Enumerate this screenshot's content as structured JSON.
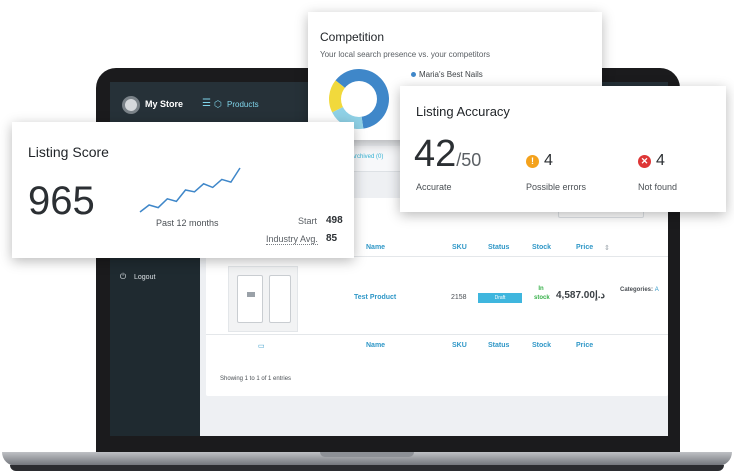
{
  "app": {
    "store_name": "My Store",
    "nav_products": "Products"
  },
  "sidebar": {
    "items": [
      {
        "label": "Logout",
        "icon": "power-icon"
      }
    ]
  },
  "tabs": {
    "archived": "Archived (0)"
  },
  "table": {
    "headers": {
      "name": "Name",
      "sku": "SKU",
      "status": "Status",
      "stock": "Stock",
      "price": "Price"
    },
    "rows": [
      {
        "name": "Test Product",
        "sku": "2158",
        "status": "Draft",
        "stock": "In stock",
        "price": "4,587.00د.إ",
        "categories_label": "Categories:",
        "categories_value": "A"
      }
    ],
    "showing": "Showing 1 to 1 of 1 entries"
  },
  "competition": {
    "title": "Competition",
    "subtitle": "Your local search presence vs. your competitors",
    "legend": [
      {
        "label": "Maria's Best Nails",
        "color": "#3f87c9"
      }
    ],
    "donut_segments": [
      {
        "value": 62,
        "color": "#3f87c9"
      },
      {
        "value": 20,
        "color": "#8fd1e6"
      },
      {
        "value": 18,
        "color": "#f1d93c"
      }
    ]
  },
  "accuracy": {
    "title": "Listing Accuracy",
    "accurate_value": "42",
    "accurate_total": "/50",
    "accurate_label": "Accurate",
    "possible_errors_value": "4",
    "possible_errors_label": "Possible errors",
    "not_found_value": "4",
    "not_found_label": "Not found"
  },
  "score": {
    "title": "Listing Score",
    "value": "965",
    "period": "Past 12 months",
    "start_label": "Start",
    "start_value": "498",
    "industry_label": "Industry Avg.",
    "industry_value": "85",
    "trend": [
      10,
      18,
      15,
      25,
      22,
      35,
      33,
      42,
      38,
      47,
      44,
      60
    ]
  },
  "colors": {
    "accent": "#2f97c7",
    "warning": "#f4a21c",
    "error": "#de3636",
    "sidebar": "#1f2a30"
  }
}
